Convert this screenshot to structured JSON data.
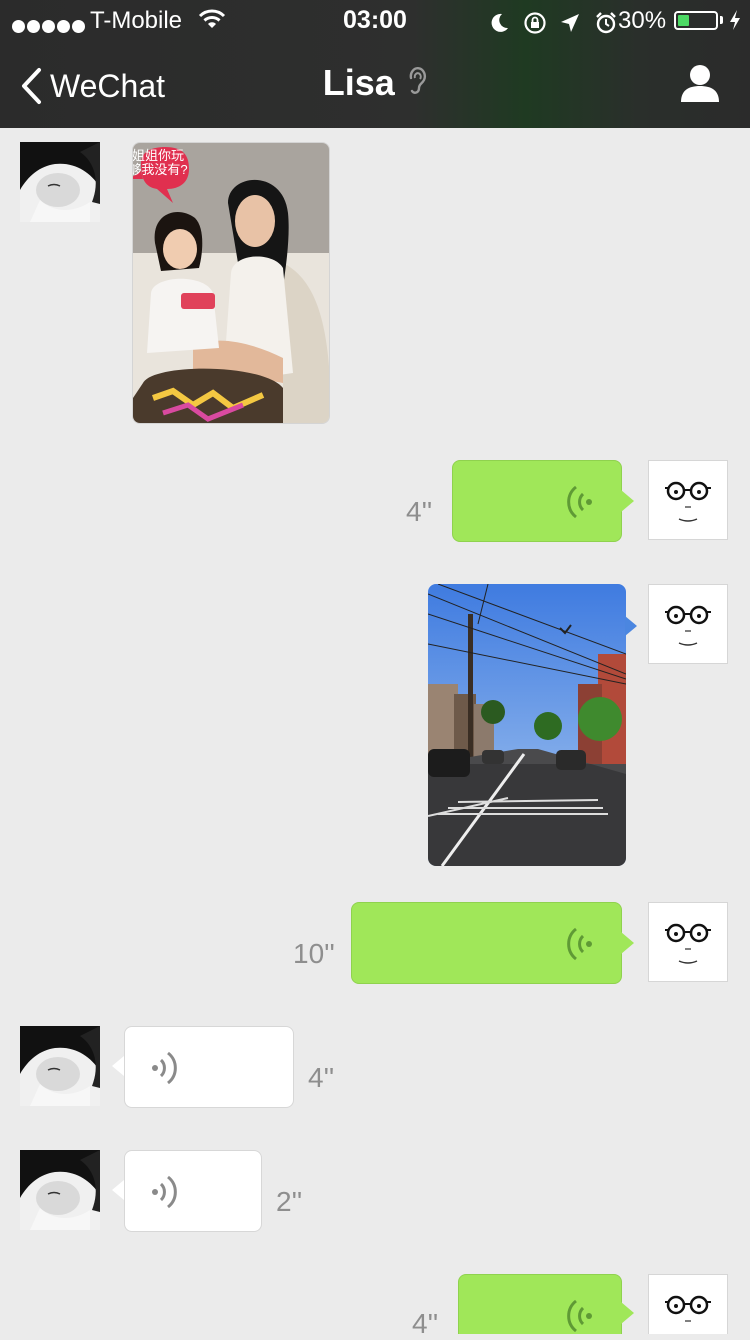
{
  "status_bar": {
    "carrier": "T-Mobile",
    "time": "03:00",
    "battery_percent": "30%",
    "battery_level": 0.3
  },
  "nav": {
    "back_label": "WeChat",
    "title": "Lisa",
    "icons": [
      "chevron-left-icon",
      "ear-icon",
      "profile-icon"
    ]
  },
  "messages": [
    {
      "sender": "Lisa",
      "type": "image",
      "sticker_text": "姐姐你玩够我没有?"
    },
    {
      "sender": "me",
      "type": "voice",
      "duration": "4''"
    },
    {
      "sender": "me",
      "type": "image",
      "subject": "street"
    },
    {
      "sender": "me",
      "type": "voice",
      "duration": "10''"
    },
    {
      "sender": "Lisa",
      "type": "voice",
      "duration": "4''"
    },
    {
      "sender": "Lisa",
      "type": "voice",
      "duration": "2''"
    },
    {
      "sender": "me",
      "type": "voice",
      "duration": "4''"
    }
  ],
  "colors": {
    "nav_bg": "#2b2b2b",
    "chat_bg": "#ebebeb",
    "outgoing_bubble": "#a0e759",
    "incoming_bubble": "#ffffff",
    "battery_fill": "#4cd964"
  }
}
